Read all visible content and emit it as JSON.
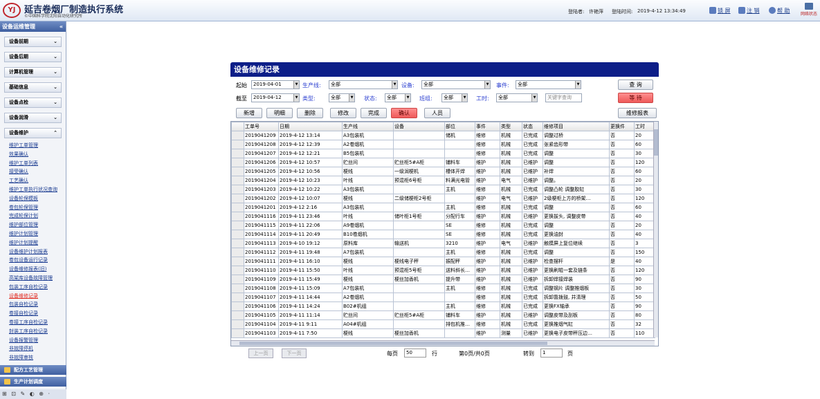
{
  "header": {
    "logo_text": "YJ",
    "app_title": "延吉卷烟厂制造执行系统",
    "app_subtitle": "©中国科学院沈阳自动化研究所",
    "login_user_label": "登陆者:",
    "login_user": "许艳萍",
    "login_time_label": "登陆时间:",
    "login_time": "2019-4-12 13:34:49",
    "lock_label": "锁 屏",
    "logout_label": "注 销",
    "help_label": "帮 助",
    "net_status": "网络状态"
  },
  "sidebar": {
    "title": "设备运维管理",
    "collapse": "«",
    "groups": [
      "设备前期",
      "设备后期",
      "计算机管理",
      "基础信息",
      "设备点检",
      "设备润滑",
      "设备维护"
    ],
    "items": [
      "维护工单管理",
      "效果确认",
      "维护工单列表",
      "接受确认",
      "工艺确认",
      "维护工单执行状况查询",
      "设备轮保模板",
      "卷包轮保管理",
      "完成轮保计划",
      "维护部位管理",
      "维护计划管理",
      "维护计划提醒",
      "设备维护计划报表",
      "卷包设备运行记录",
      "设备维修报表(旧)",
      "高架库设备故障管理",
      "包装工序自检记录",
      "设备维修记录",
      "包装自检记录",
      "卷接自检记录",
      "卷接工序自检记录",
      "封装工序自检记录",
      "设备报警管理",
      "非故障停机",
      "非故障审核"
    ],
    "active": 17,
    "bottom": [
      "配方工艺管理",
      "生产计划调度"
    ],
    "tray": "⊞ ⊡ ✎ ◐ ⊕ ·"
  },
  "form": {
    "title": "设备维修记录",
    "start_label": "起始",
    "start_date": "2019-04-01",
    "end_label": "截至",
    "end_date": "2019-04-12",
    "line_label": "生产线:",
    "line_value": "全部",
    "equip_label": "设备:",
    "equip_value": "全部",
    "event_label": "事件:",
    "event_value": "全部",
    "type_label": "类型:",
    "type_value": "全部",
    "status_label": "状态:",
    "status_value": "全部",
    "shift_label": "班组:",
    "shift_value": "全部",
    "hours_label": "工时:",
    "hours_value": "全部",
    "keyword_placeholder": "关键字查询",
    "query_label": "查 询",
    "wait_label": "等 待",
    "buttons": [
      "新增",
      "明细",
      "删除",
      "修改",
      "完成",
      "确认",
      "人员"
    ],
    "report_label": "维修报表"
  },
  "table": {
    "columns": [
      "工单号",
      "日期",
      "生产线",
      "设备",
      "部位",
      "事件",
      "类型",
      "状态",
      "维修项目",
      "更换件",
      "工时"
    ],
    "rows": [
      [
        "2019041209",
        "2019-4-12 13:14",
        "A3包装机",
        "",
        "储机",
        "维修",
        "机械",
        "已完成",
        "调整过桥",
        "否",
        "20"
      ],
      [
        "2019041208",
        "2019-4-12 12:39",
        "A2卷烟机",
        "",
        "",
        "维修",
        "机械",
        "已完成",
        "张紧齿形带",
        "否",
        "60"
      ],
      [
        "2019041207",
        "2019-4-12 12:21",
        "B5包装机",
        "",
        "",
        "维修",
        "机械",
        "已完成",
        "调整",
        "否",
        "30"
      ],
      [
        "2019041206",
        "2019-4-12 10:57",
        "贮丝间",
        "贮丝柜5#A柜",
        "铺料车",
        "维护",
        "机械",
        "已维护",
        "调整",
        "否",
        "120"
      ],
      [
        "2019041205",
        "2019-4-12 10:56",
        "梗线",
        "一级润梗机",
        "槽体开焊",
        "维护",
        "机械",
        "已维护",
        "补焊",
        "否",
        "60"
      ],
      [
        "2019041204",
        "2019-4-12 10:23",
        "叶线",
        "预混柜6号柜",
        "料满光电管",
        "维护",
        "电气",
        "已维护",
        "调整。",
        "否",
        "20"
      ],
      [
        "2019041203",
        "2019-4-12 10:22",
        "A3包装机",
        "",
        "主机",
        "维修",
        "机械",
        "已完成",
        "调整凸轮 调整胶缸",
        "否",
        "30"
      ],
      [
        "2019041202",
        "2019-4-12 10:07",
        "梗线",
        "二级储梗柜2号柜",
        "",
        "维护",
        "电气",
        "已维护",
        "2级梗柜上方的桥架…",
        "否",
        "120"
      ],
      [
        "2019041201",
        "2019-4-12 2:16",
        "A3包装机",
        "",
        "主机",
        "维修",
        "机械",
        "已完成",
        "调整",
        "否",
        "60"
      ],
      [
        "2019041116",
        "2019-4-11 23:46",
        "叶线",
        "储叶柜1号柜",
        "分配行车",
        "维护",
        "机械",
        "已维护",
        "更换拔头, 调整皮带",
        "否",
        "40"
      ],
      [
        "2019041115",
        "2019-4-11 22:06",
        "A9卷烟机",
        "",
        "SE",
        "维修",
        "机械",
        "已完成",
        "调整",
        "否",
        "20"
      ],
      [
        "2019041114",
        "2019-4-11 20:49",
        "B10卷烟机",
        "",
        "SE",
        "维修",
        "机械",
        "已完成",
        "更换油封",
        "否",
        "40"
      ],
      [
        "2019041113",
        "2019-4-10 19:12",
        "原料库",
        "输送机",
        "3210",
        "维护",
        "电气",
        "已维护",
        "触摸屏上复位继续",
        "否",
        "3"
      ],
      [
        "2019041112",
        "2019-4-11 19:48",
        "A7包装机",
        "",
        "主机",
        "维修",
        "机械",
        "已完成",
        "调整",
        "否",
        "150"
      ],
      [
        "2019041111",
        "2019-4-11 16:10",
        "梗线",
        "梗线电子秤",
        "振配秤",
        "维护",
        "机械",
        "已维护",
        "检查摆杆",
        "是",
        "40"
      ],
      [
        "2019041110",
        "2019-4-11 15:50",
        "叶线",
        "预混柜5号柜",
        "送料斜长…",
        "维护",
        "机械",
        "已维护",
        "更换刷辊一套及链条",
        "否",
        "120"
      ],
      [
        "2019041109",
        "2019-4-11 15:49",
        "梗线",
        "梗丝加香机",
        "提升带",
        "维护",
        "机械",
        "已维护",
        "拆卸焊接焊装",
        "否",
        "90"
      ],
      [
        "2019041108",
        "2019-4-11 15:09",
        "A7包装机",
        "",
        "主机",
        "维修",
        "机械",
        "已完成",
        "调整钢片 调整推烟板",
        "否",
        "30"
      ],
      [
        "2019041107",
        "2019-4-11 14:44",
        "A2卷烟机",
        "",
        "",
        "维修",
        "机械",
        "已完成",
        "拆卸靠拨鼓, 并清理",
        "否",
        "50"
      ],
      [
        "2019041106",
        "2019-4-11 14:24",
        "B02#机组",
        "",
        "主机",
        "维修",
        "机械",
        "已完成",
        "更换FX轴承",
        "否",
        "90"
      ],
      [
        "2019041105",
        "2019-4-11 11:14",
        "贮丝间",
        "贮丝柜5#A柜",
        "铺料车",
        "维护",
        "机械",
        "已维护",
        "调整皮带及刮板",
        "否",
        "80"
      ],
      [
        "2019041104",
        "2019-4-11 9:11",
        "A04#机组",
        "",
        "排包机推…",
        "维修",
        "机械",
        "已完成",
        "更换推烟气缸",
        "否",
        "32"
      ],
      [
        "2019041103",
        "2019-4-11 7:50",
        "梗线",
        "梗丝加香机",
        "",
        "维护",
        "测量",
        "已维护",
        "更换电子皮带秤压边…",
        "否",
        "110"
      ]
    ]
  },
  "pager": {
    "prev": "上一页",
    "next": "下一页",
    "per_page_label": "每页",
    "per_page": "50",
    "rows_label": "行",
    "page_info": "第0页/共0页",
    "goto_label": "转到",
    "goto_value": "1",
    "page_label": "页"
  }
}
